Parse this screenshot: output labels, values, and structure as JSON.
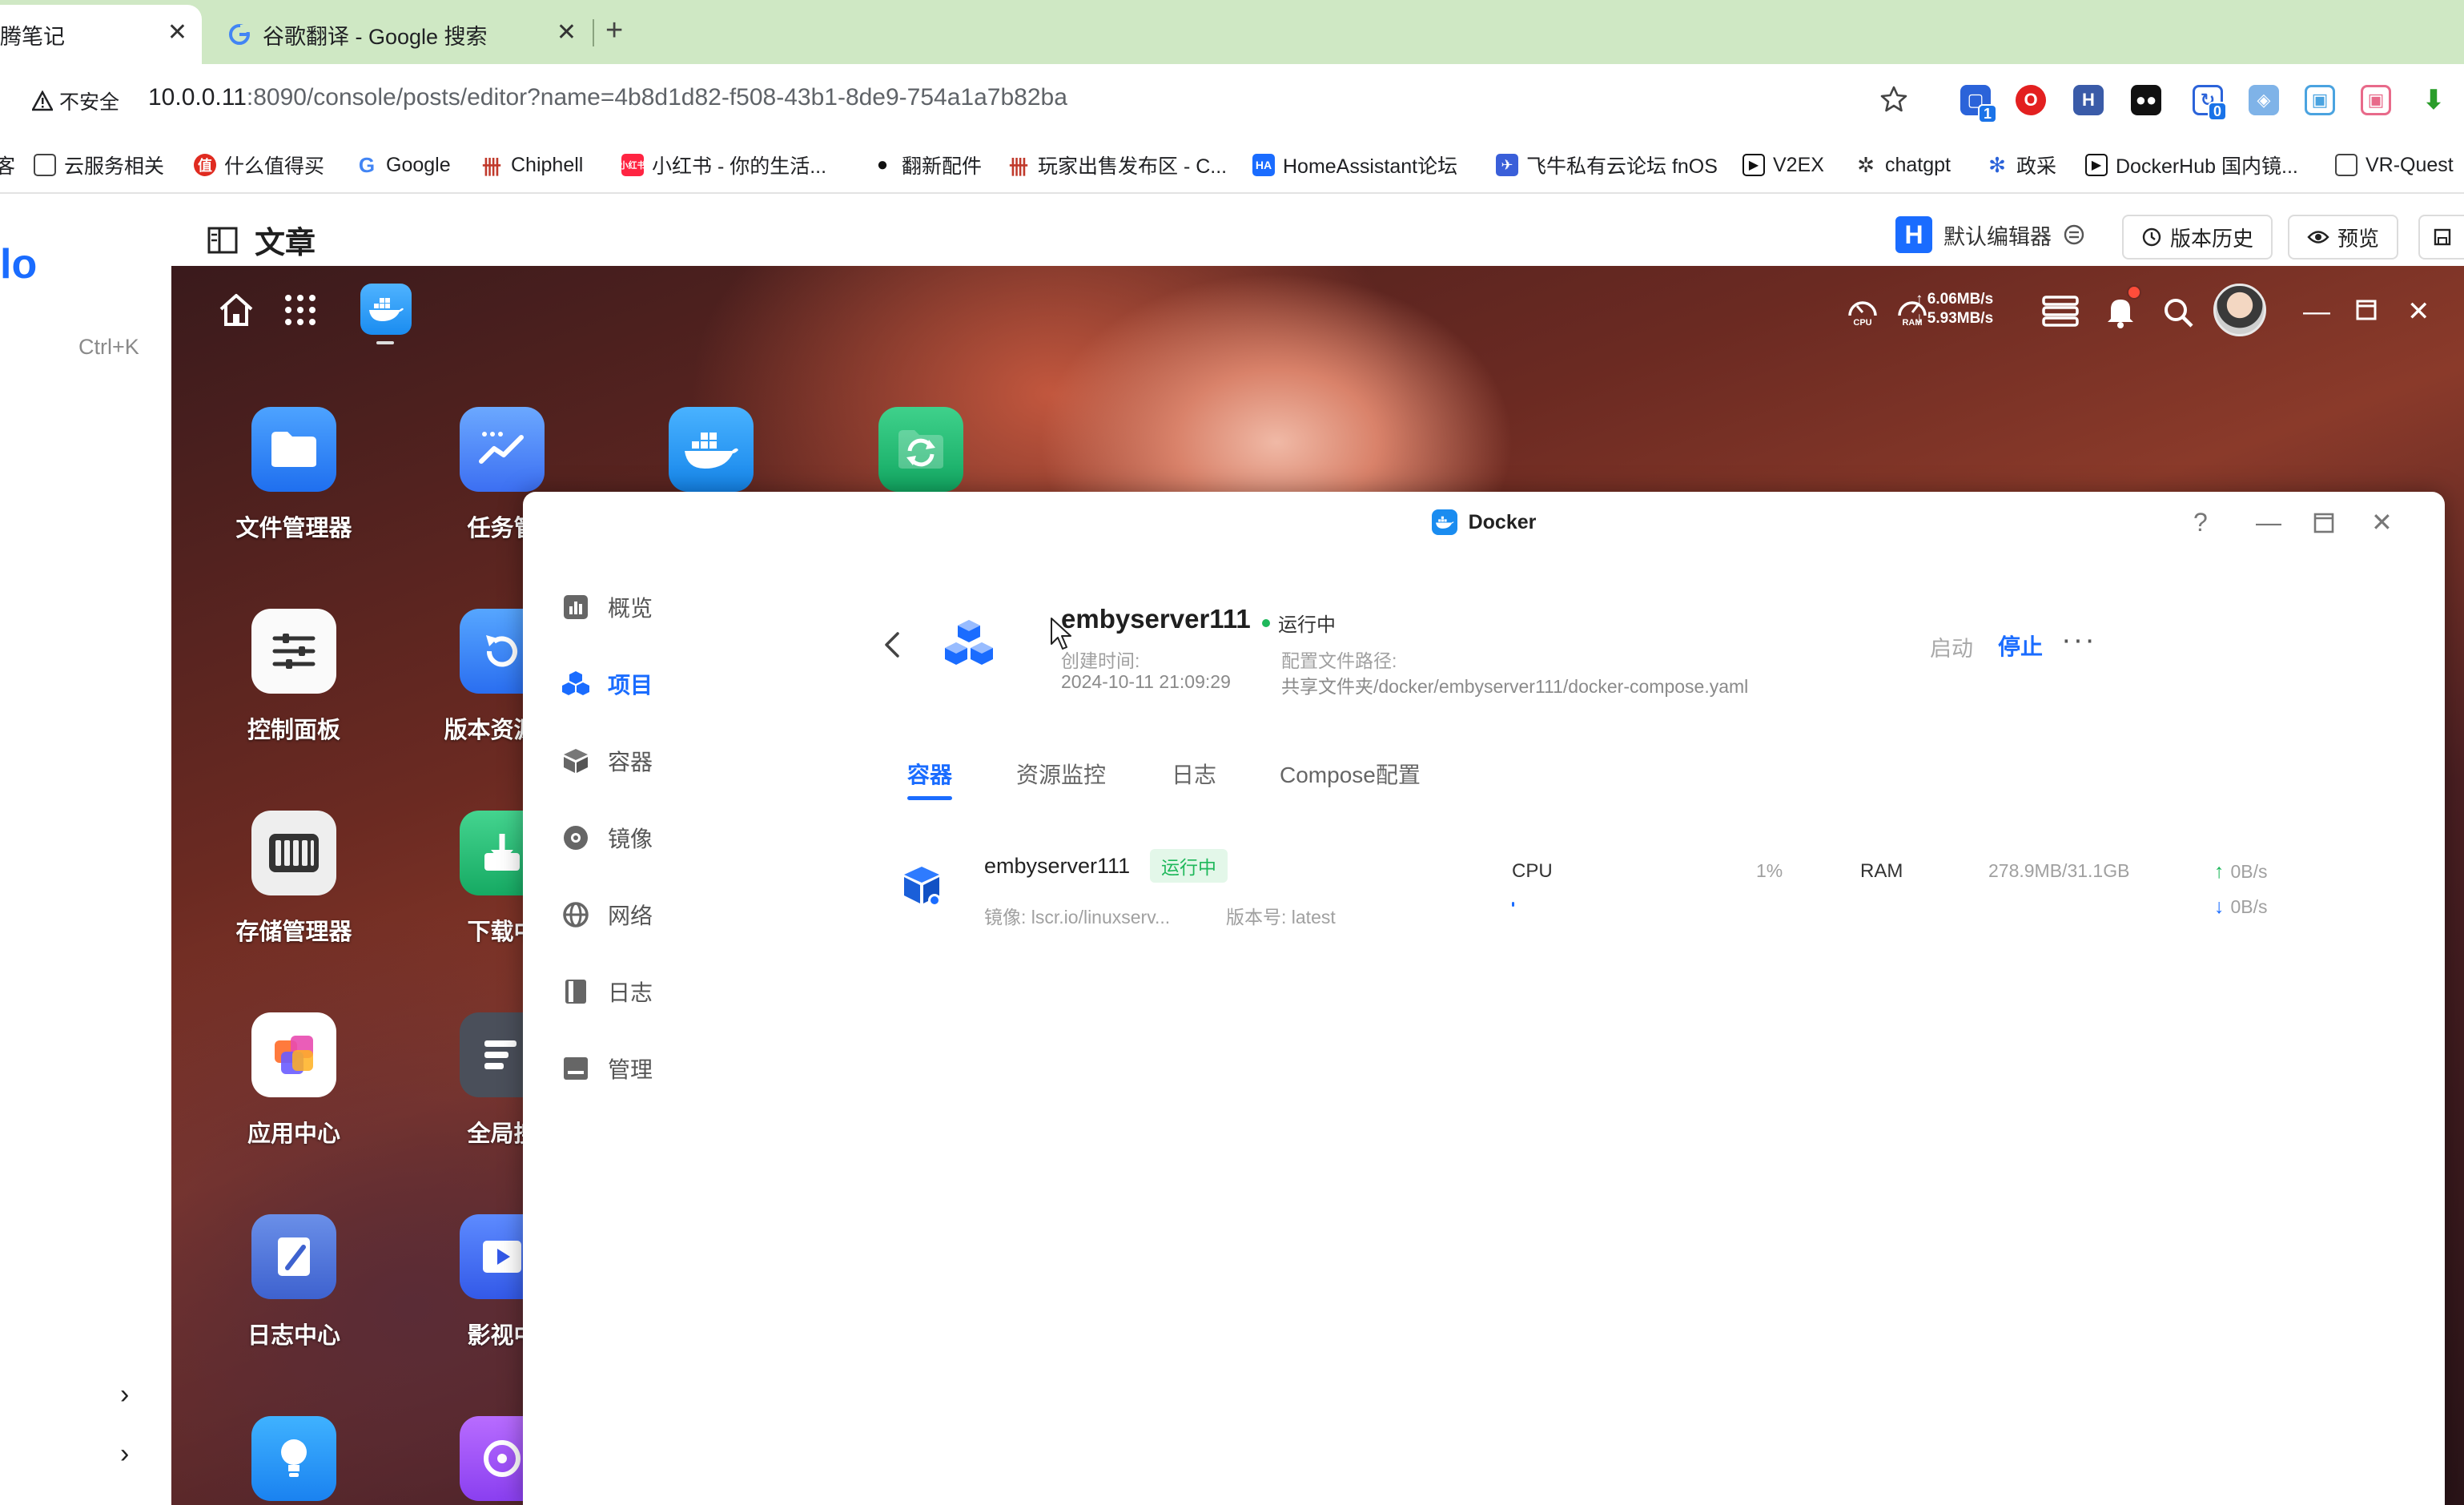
{
  "browser": {
    "tabs": [
      {
        "title": "腾笔记",
        "close": "✕"
      },
      {
        "title": "谷歌翻译 - Google 搜索",
        "close": "✕"
      }
    ],
    "new_tab": "+",
    "security_label": "不安全",
    "url_host": "10.0.0.11",
    "url_path": ":8090/console/posts/editor?name=4b8d1d82-f508-43b1-8de9-754a1a7b82ba",
    "extension_badges": [
      "1",
      "0"
    ],
    "bookmarks": [
      {
        "label": "客",
        "icon": "bookmark-icon"
      },
      {
        "label": "云服务相关",
        "icon": "folder-icon"
      },
      {
        "label": "什么值得买",
        "icon": "smzdm-icon"
      },
      {
        "label": "Google",
        "icon": "google-icon"
      },
      {
        "label": "Chiphell",
        "icon": "chiphell-icon"
      },
      {
        "label": "小红书 - 你的生活...",
        "icon": "xiaohongshu-icon"
      },
      {
        "label": "翻新配件",
        "icon": "apple-icon"
      },
      {
        "label": "玩家出售发布区 - C...",
        "icon": "chiphell-icon"
      },
      {
        "label": "HomeAssistant论坛",
        "icon": "homeassistant-icon"
      },
      {
        "label": "飞牛私有云论坛 fnOS",
        "icon": "fnos-icon"
      },
      {
        "label": "V2EX",
        "icon": "v2ex-icon"
      },
      {
        "label": "chatgpt",
        "icon": "openai-icon"
      },
      {
        "label": "政采",
        "icon": "gov-icon"
      },
      {
        "label": "DockerHub 国内镜...",
        "icon": "docker-icon"
      },
      {
        "label": "VR-Quest",
        "icon": "folder-icon"
      }
    ]
  },
  "page": {
    "logo": "lo",
    "search_shortcut": "Ctrl+K",
    "title": "文章",
    "editor_label": "默认编辑器",
    "version_history": "版本历史",
    "preview": "预览"
  },
  "desktop": {
    "net_up": "↑ 6.06MB/s",
    "net_down": "↓ 5.93MB/s",
    "tray_cpu": "CPU",
    "tray_ram": "RAM",
    "apps": [
      {
        "label": "文件管理器",
        "icon": "folder-icon"
      },
      {
        "label": "任务管",
        "icon": "task-manager-icon"
      },
      {
        "label": "",
        "icon": "docker-icon"
      },
      {
        "label": "",
        "icon": "sync-folder-icon"
      },
      {
        "label": "控制面板",
        "icon": "control-panel-icon"
      },
      {
        "label": "版本资源管",
        "icon": "version-icon"
      },
      {
        "label": "存储管理器",
        "icon": "storage-icon"
      },
      {
        "label": "下载中",
        "icon": "download-icon"
      },
      {
        "label": "应用中心",
        "icon": "app-center-icon"
      },
      {
        "label": "全局搜",
        "icon": "search-app-icon"
      },
      {
        "label": "日志中心",
        "icon": "log-center-icon"
      },
      {
        "label": "影视中",
        "icon": "video-icon"
      },
      {
        "label": "",
        "icon": "bulb-icon"
      },
      {
        "label": "",
        "icon": "music-icon"
      }
    ]
  },
  "docker": {
    "window_title": "Docker",
    "nav": [
      {
        "label": "概览",
        "icon": "overview-icon",
        "active": false
      },
      {
        "label": "项目",
        "icon": "project-icon",
        "active": true
      },
      {
        "label": "容器",
        "icon": "container-icon",
        "active": false
      },
      {
        "label": "镜像",
        "icon": "image-icon",
        "active": false
      },
      {
        "label": "网络",
        "icon": "network-icon",
        "active": false
      },
      {
        "label": "日志",
        "icon": "log-icon",
        "active": false
      },
      {
        "label": "管理",
        "icon": "manage-icon",
        "active": false
      }
    ],
    "project": {
      "name": "embyserver111",
      "status": "运行中",
      "created_label": "创建时间:",
      "created_value": "2024-10-11 21:09:29",
      "config_label": "配置文件路径:",
      "config_value": "共享文件夹/docker/embyserver111/docker-compose.yaml",
      "start": "启动",
      "stop": "停止",
      "more": "···"
    },
    "tabs": [
      "容器",
      "资源监控",
      "日志",
      "Compose配置"
    ],
    "container": {
      "name": "embyserver111",
      "status": "运行中",
      "image": "镜像: lscr.io/linuxserv...",
      "version": "版本号: latest",
      "cpu_label": "CPU",
      "cpu_value": "1%",
      "cpu_fraction": 0.01,
      "ram_label": "RAM",
      "ram_value": "278.9MB/31.1GB",
      "net_up": "0B/s",
      "net_down": "0B/s"
    }
  },
  "colors": {
    "accent": "#1a6cff",
    "running_green": "#1fb85b",
    "tabbar": "#cfe8c4"
  }
}
